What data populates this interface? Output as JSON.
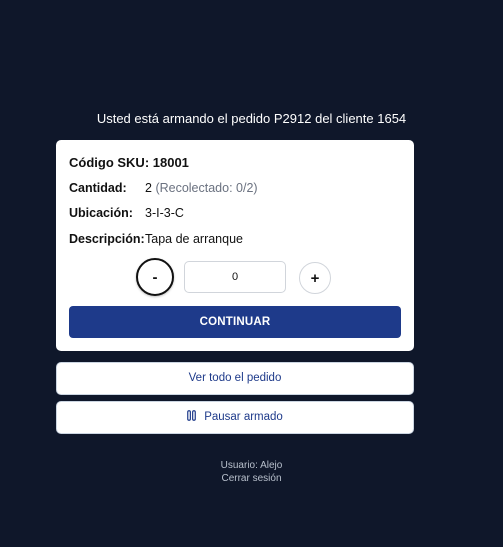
{
  "header": {
    "text": "Usted está armando el pedido P2912 del cliente 1654"
  },
  "item": {
    "sku": "Código SKU: 18001",
    "quantity_label": "Cantidad:",
    "quantity_value": "2",
    "quantity_note": "(Recolectado: 0/2)",
    "location_label": "Ubicación:",
    "location_value": "3-I-3-C",
    "description_label": "Descripción:",
    "description_value": "Tapa de arranque"
  },
  "stepper": {
    "minus_label": "-",
    "value": "0",
    "plus_label": "+"
  },
  "actions": {
    "continue_label": "CONTINUAR",
    "view_order_label": "Ver todo el pedido",
    "pause_label": "Pausar armado"
  },
  "footer": {
    "user": "Usuario: Alejo",
    "logout": "Cerrar sesión"
  },
  "colors": {
    "background": "#0f172a",
    "primary": "#1e3a8a",
    "card": "#ffffff"
  },
  "icons": {
    "pause": "pause-icon"
  }
}
